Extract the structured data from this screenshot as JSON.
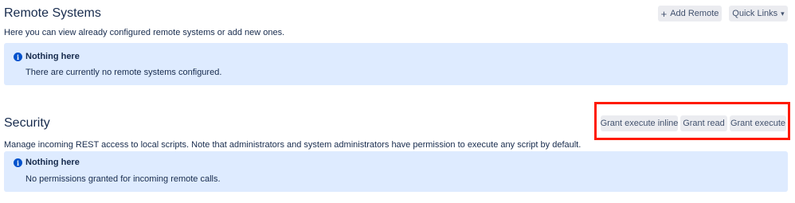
{
  "remote": {
    "title": "Remote Systems",
    "add_button": "Add Remote",
    "quick_links": "Quick Links",
    "description": "Here you can view already configured remote systems or add new ones.",
    "info_title": "Nothing here",
    "info_text": "There are currently no remote systems configured."
  },
  "security": {
    "title": "Security",
    "buttons": [
      "Grant execute inline",
      "Grant read",
      "Grant execute"
    ],
    "description": "Manage incoming REST access to local scripts. Note that administrators and system administrators have permission to execute any script by default.",
    "info_title": "Nothing here",
    "info_text": "No permissions granted for incoming remote calls."
  },
  "icons": {
    "info": "info-icon",
    "add": "plus-icon",
    "dropdown": "chevron-down-icon"
  },
  "colors": {
    "info_background": "#deebff",
    "info_icon": "#0052cc",
    "button_background": "#ebecf0",
    "highlight": "#ff1a00"
  }
}
